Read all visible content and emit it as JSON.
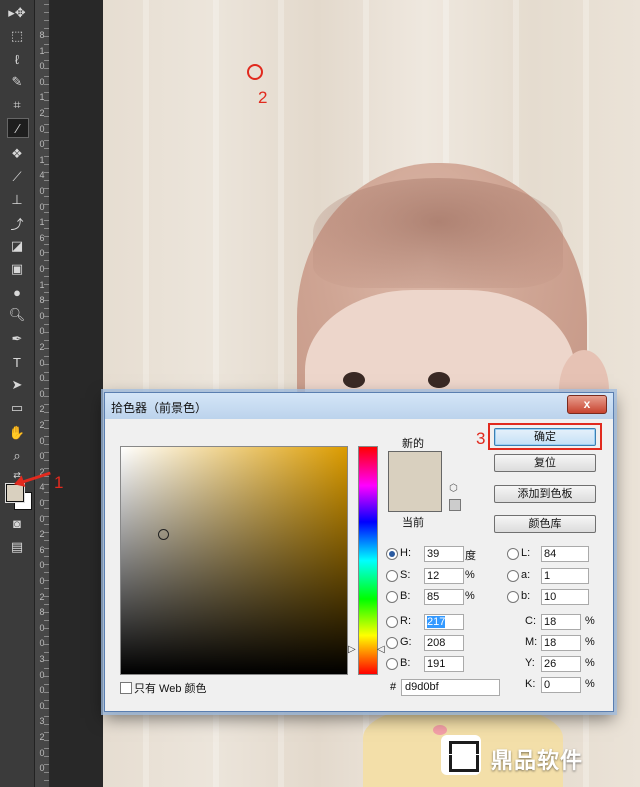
{
  "tools": [
    "move-icon",
    "marquee-icon",
    "lasso-icon",
    "quick-select-icon",
    "crop-icon",
    "eyedropper-icon",
    "spot-heal-icon",
    "brush-icon",
    "stamp-icon",
    "history-brush-icon",
    "eraser-icon",
    "gradient-icon",
    "blur-icon",
    "dodge-icon",
    "pen-icon",
    "type-icon",
    "path-select-icon",
    "rectangle-icon",
    "hand-icon",
    "zoom-icon"
  ],
  "ruler_labels": [
    "8",
    "1",
    "0",
    "0",
    "1",
    "2",
    "0",
    "0",
    "1",
    "4",
    "0",
    "0",
    "1",
    "6",
    "0",
    "0",
    "1",
    "8",
    "0",
    "0",
    "2",
    "0",
    "0",
    "0",
    "2",
    "2",
    "0",
    "0",
    "2",
    "4",
    "0",
    "0",
    "2",
    "6",
    "0",
    "0",
    "2",
    "8",
    "0",
    "0",
    "3",
    "0",
    "0",
    "0",
    "3",
    "2",
    "0",
    "0"
  ],
  "annotations": {
    "one": "1",
    "two": "2",
    "three": "3"
  },
  "colors": {
    "foreground": "#d9d0bf",
    "accent_red": "#e12a1e"
  },
  "dialog": {
    "title": "拾色器（前景色）",
    "close": "x",
    "new_label": "新的",
    "current_label": "当前",
    "buttons": {
      "ok": "确定",
      "reset": "复位",
      "add_swatch": "添加到色板",
      "libraries": "颜色库"
    },
    "hsb": [
      {
        "label": "H:",
        "value": "39",
        "unit": "度",
        "selected": true
      },
      {
        "label": "S:",
        "value": "12",
        "unit": "%",
        "selected": false
      },
      {
        "label": "B:",
        "value": "85",
        "unit": "%",
        "selected": false
      }
    ],
    "rgb": [
      {
        "label": "R:",
        "value": "217"
      },
      {
        "label": "G:",
        "value": "208"
      },
      {
        "label": "B:",
        "value": "191"
      }
    ],
    "lab": [
      {
        "label": "L:",
        "value": "84"
      },
      {
        "label": "a:",
        "value": "1"
      },
      {
        "label": "b:",
        "value": "10"
      }
    ],
    "cmyk": [
      {
        "label": "C:",
        "value": "18",
        "unit": "%"
      },
      {
        "label": "M:",
        "value": "18",
        "unit": "%"
      },
      {
        "label": "Y:",
        "value": "26",
        "unit": "%"
      },
      {
        "label": "K:",
        "value": "0",
        "unit": "%"
      }
    ],
    "hash": "#",
    "hex": "d9d0bf",
    "web_only": "只有 Web 颜色"
  },
  "logo_text": "鼎品软件"
}
